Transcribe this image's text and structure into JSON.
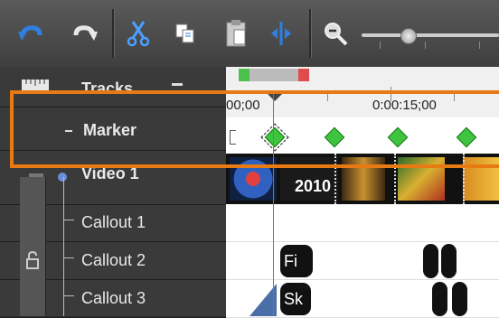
{
  "toolbar": {
    "icons": [
      "undo-icon",
      "redo-icon",
      "cut-icon",
      "copy-icon",
      "paste-icon",
      "split-icon",
      "zoom-out-icon"
    ]
  },
  "tracks": {
    "header_label": "Tracks",
    "marker_label": "Marker",
    "video_label": "Video 1",
    "callouts": [
      "Callout 1",
      "Callout 2",
      "Callout 3"
    ]
  },
  "timeline": {
    "time_start": "00;00",
    "time_15": "0:00:15;00",
    "video_overlay_text": "2010",
    "clip_callout2": "Fi",
    "clip_callout3": "Sk"
  },
  "colors": {
    "highlight": "#e87a14",
    "marker": "#3ec43e",
    "playhead": "#4a7fd0",
    "undo_blue": "#2f7fe0"
  }
}
